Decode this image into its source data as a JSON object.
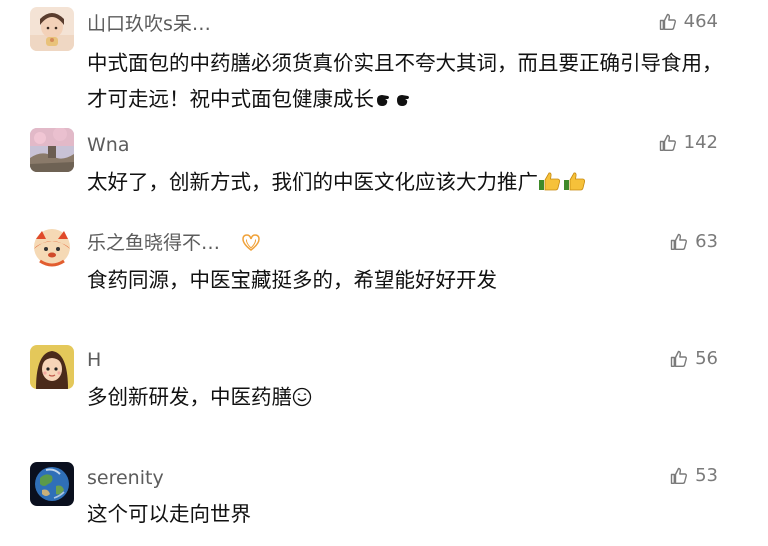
{
  "comments": [
    {
      "username": "山口玖吹s呆…",
      "likes": "464",
      "text": "中式面包的中药膳必须货真价实且不夸大其词，而且要正确引导食用，才可走远！祝中式面包健康成长",
      "emoji": "fist-emoji"
    },
    {
      "username": "Wna",
      "likes": "142",
      "text": "太好了，创新方式，我们的中医文化应该大力推广",
      "emoji": "thumbs-up-emoji"
    },
    {
      "username": "乐之鱼晓得不…",
      "likes": "63",
      "text": "食药同源，中医宝藏挺多的，希望能好好开发",
      "badge": "orange-heart-badge-icon"
    },
    {
      "username": "H",
      "likes": "56",
      "text": "多创新研发，中医药膳",
      "emoji": "smile-emoji"
    },
    {
      "username": "serenity",
      "likes": "53",
      "text": "这个可以走向世界"
    }
  ],
  "colors": {
    "username": "#5c5c5c",
    "text": "#111111",
    "likes": "#7a7a7a",
    "badge": "#f0a23a",
    "thumb_yellow": "#f6c13a"
  }
}
